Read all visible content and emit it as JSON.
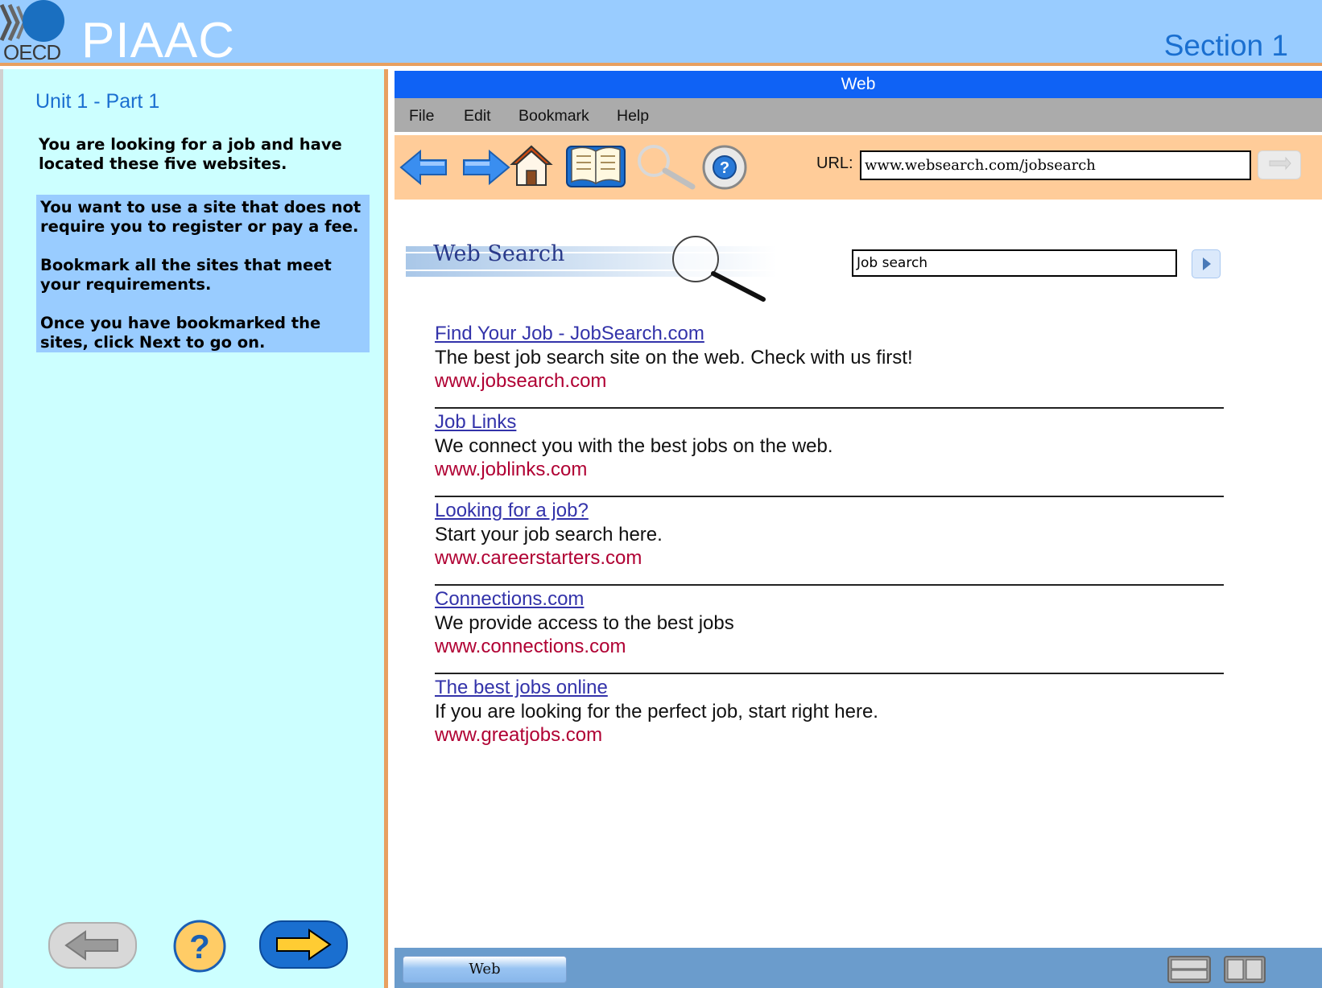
{
  "header": {
    "oecd_text": "OECD",
    "app_title": "PIAAC",
    "section_label": "Section 1"
  },
  "left_panel": {
    "unit_label": "Unit 1 - Part 1",
    "intro_text": "You are looking for a job and have located these five websites.",
    "instructions": [
      "You want to use a site that does not require you to register or pay a fee.",
      "Bookmark all the sites that meet your requirements.",
      "Once you have bookmarked the sites, click Next to go on."
    ]
  },
  "browser": {
    "window_title": "Web",
    "menu": [
      "File",
      "Edit",
      "Bookmark",
      "Help"
    ],
    "toolbar_icons": [
      "back-arrow-icon",
      "forward-arrow-icon",
      "home-icon",
      "bookmarks-book-icon",
      "search-magnifier-icon",
      "help-lifebuoy-icon"
    ],
    "url_label": "URL:",
    "url_value": "www.websearch.com/jobsearch",
    "page": {
      "logo_text": "Web Search",
      "search_value": "Job search",
      "results": [
        {
          "title": "Find Your Job - JobSearch.com",
          "description": "The best job search site on the web.  Check with us first!",
          "url": "www.jobsearch.com"
        },
        {
          "title": "Job Links",
          "description": "We connect you with the best jobs on the web.",
          "url": "www.joblinks.com"
        },
        {
          "title": "Looking for a job?",
          "description": "Start your job search here.",
          "url": "www.careerstarters.com"
        },
        {
          "title": "Connections.com",
          "description": "We provide access to the best jobs",
          "url": "www.connections.com"
        },
        {
          "title": "The best jobs online",
          "description": "If you are looking for the perfect job, start right here.",
          "url": "www.greatjobs.com"
        }
      ]
    },
    "taskbar": {
      "tab_label": "Web"
    }
  },
  "colors": {
    "header_bg": "#99ccff",
    "left_panel_bg": "#ccffff",
    "instruction_box_bg": "#99ccff",
    "accent_orange": "#e8a060",
    "titlebar_blue": "#0f62f5",
    "toolbar_bg": "#ffcc99",
    "link_color": "#3333aa",
    "url_color": "#b00033",
    "taskbar_bg": "#6b9ccc"
  }
}
